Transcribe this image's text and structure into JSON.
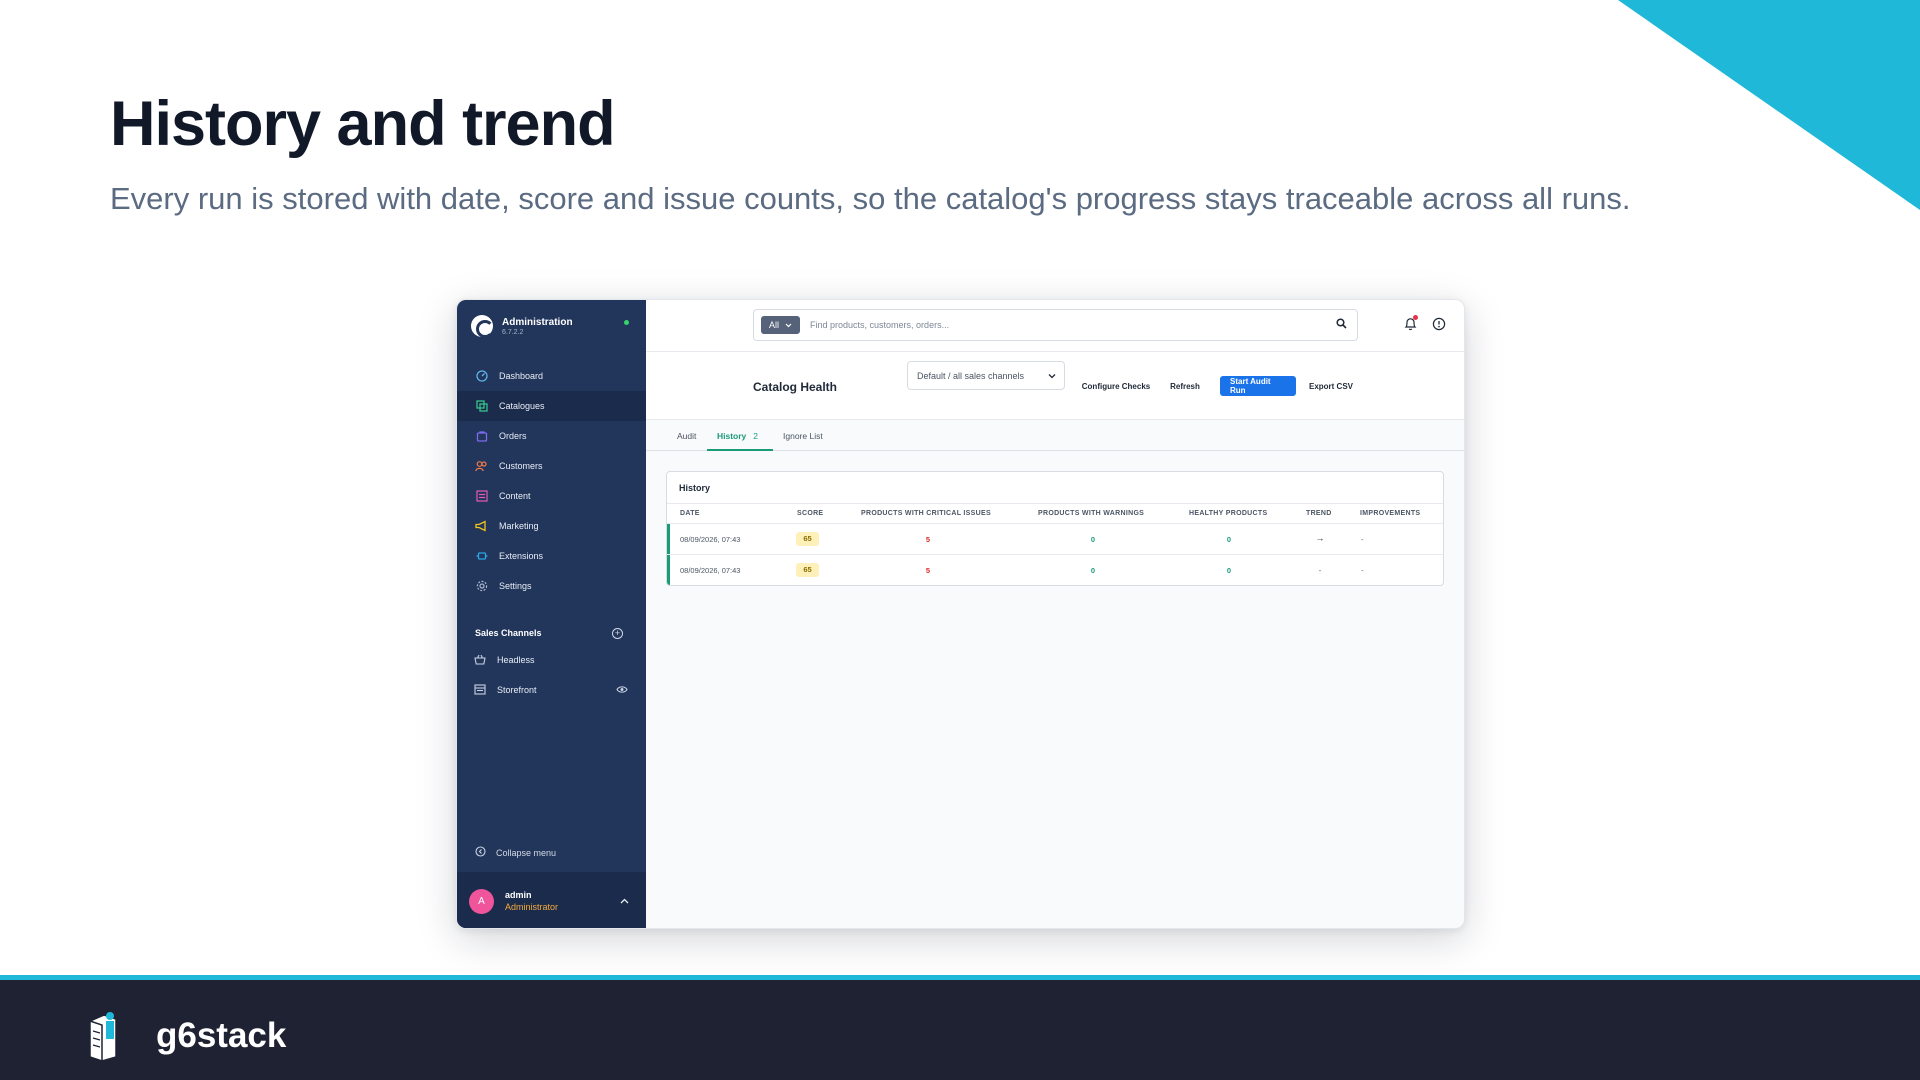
{
  "slide": {
    "title": "History and trend",
    "subtitle": "Every run is stored with date, score and issue counts, so the catalog's progress stays traceable across all runs.",
    "brand": "g6stack",
    "accent_color": "#1fb8d8"
  },
  "sidebar": {
    "app_title": "Administration",
    "version": "6.7.2.2",
    "nav": [
      {
        "label": "Dashboard",
        "icon": "dashboard-icon",
        "color": "#5fb3e8"
      },
      {
        "label": "Catalogues",
        "icon": "catalogue-icon",
        "color": "#37c28a",
        "active": true
      },
      {
        "label": "Orders",
        "icon": "orders-icon",
        "color": "#7c6cf0"
      },
      {
        "label": "Customers",
        "icon": "customers-icon",
        "color": "#f27a4b"
      },
      {
        "label": "Content",
        "icon": "content-icon",
        "color": "#e65bb5"
      },
      {
        "label": "Marketing",
        "icon": "marketing-icon",
        "color": "#f5c518"
      },
      {
        "label": "Extensions",
        "icon": "extensions-icon",
        "color": "#2aa8e6"
      },
      {
        "label": "Settings",
        "icon": "settings-icon",
        "color": "#a9b6cd"
      }
    ],
    "sales_channels_heading": "Sales Channels",
    "sales_channels": [
      {
        "label": "Headless",
        "icon": "basket-icon"
      },
      {
        "label": "Storefront",
        "icon": "storefront-icon"
      }
    ],
    "collapse_label": "Collapse menu",
    "user": {
      "initial": "A",
      "name": "admin",
      "role": "Administrator"
    }
  },
  "topbar": {
    "search_scope": "All",
    "search_placeholder": "Find products, customers, orders..."
  },
  "header": {
    "page_title": "Catalog Health",
    "channel_select": "Default / all sales channels",
    "buttons": {
      "configure": "Configure Checks",
      "refresh": "Refresh",
      "start": "Start Audit Run",
      "export": "Export CSV"
    }
  },
  "tabs": {
    "audit": "Audit",
    "history": "History",
    "history_count": "2",
    "ignore": "Ignore List"
  },
  "history": {
    "title": "History",
    "columns": [
      "DATE",
      "SCORE",
      "PRODUCTS WITH CRITICAL ISSUES",
      "PRODUCTS WITH WARNINGS",
      "HEALTHY PRODUCTS",
      "TREND",
      "IMPROVEMENTS"
    ],
    "rows": [
      {
        "date": "08/09/2026, 07:43",
        "score": "65",
        "critical": "5",
        "warnings": "0",
        "healthy": "0",
        "trend": "→",
        "improvements": "-"
      },
      {
        "date": "08/09/2026, 07:43",
        "score": "65",
        "critical": "5",
        "warnings": "0",
        "healthy": "0",
        "trend": "-",
        "improvements": "-"
      }
    ]
  }
}
